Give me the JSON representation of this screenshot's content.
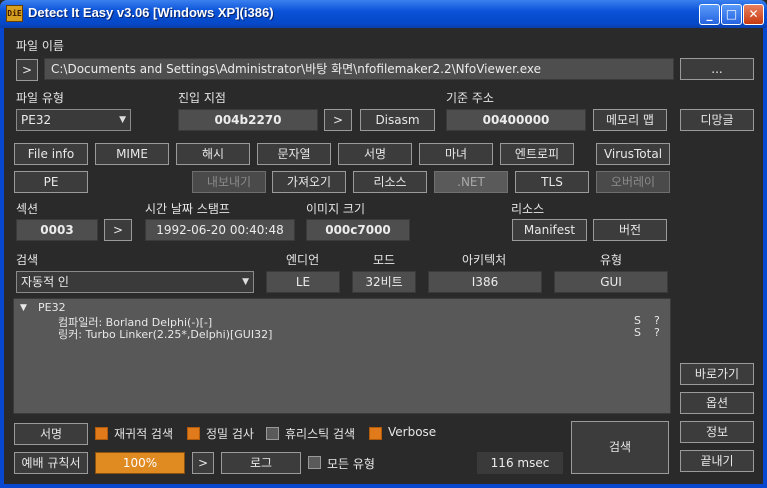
{
  "window": {
    "title": "Detect It Easy v3.06 [Windows XP](i386)",
    "app_icon": "DiE"
  },
  "file": {
    "label": "파일 이름",
    "path": "C:\\Documents and Settings\\Administrator\\바탕 화면\\nfofilemaker2.2\\NfoViewer.exe",
    "browse_label": "...",
    "expand_label": ">"
  },
  "file_type": {
    "label": "파일 유형",
    "value": "PE32"
  },
  "entry_point": {
    "label": "진입 지점",
    "value": "004b2270",
    "go_label": ">",
    "disasm_label": "Disasm"
  },
  "base_address": {
    "label": "기준 주소",
    "value": "00400000",
    "memory_map_label": "메모리 맵"
  },
  "side_buttons": {
    "unpack": "디망글",
    "goto": "바로가기",
    "options": "옵션",
    "info": "정보",
    "exit": "끝내기"
  },
  "toolbar_row1": [
    "File info",
    "MIME",
    "해시",
    "문자열",
    "서명",
    "마녀",
    "엔트로피",
    "VirusTotal"
  ],
  "toolbar_row2": {
    "pe": "PE",
    "export": "내보내기",
    "import": "가져오기",
    "resources": "리소스",
    "dotnet": ".NET",
    "tls": "TLS",
    "overlay": "오버레이"
  },
  "sections": {
    "label": "섹션",
    "value": "0003",
    "go_label": ">"
  },
  "timestamp": {
    "label": "시간 날짜 스탬프",
    "value": "1992-06-20 00:40:48"
  },
  "image_size": {
    "label": "이미지 크기",
    "value": "000c7000"
  },
  "resources_group": {
    "label": "리소스",
    "manifest": "Manifest",
    "version": "버전"
  },
  "scan": {
    "label": "검색",
    "value": "자동적 인"
  },
  "endian": {
    "label": "엔디언",
    "value": "LE"
  },
  "mode": {
    "label": "모드",
    "value": "32비트"
  },
  "architecture": {
    "label": "아키텍처",
    "value": "I386"
  },
  "type": {
    "label": "유형",
    "value": "GUI"
  },
  "results": {
    "root": "PE32",
    "items": [
      {
        "text": "컴파일러: Borland Delphi(-)[-]",
        "s": "S",
        "q": "?"
      },
      {
        "text": "링커: Turbo Linker(2.25*,Delphi)[GUI32]",
        "s": "S",
        "q": "?"
      }
    ]
  },
  "bottom": {
    "signatures": "서명",
    "recursive_scan": "재귀적 검색",
    "deep_scan": "정밀 검사",
    "heuristic_scan": "휴리스틱 검색",
    "verbose": "Verbose",
    "exception_rules": "예배 규칙서",
    "progress": "100%",
    "progress_value": 100,
    "go_label": ">",
    "log": "로그",
    "all_types": "모든 유형",
    "elapsed": "116 msec",
    "scan_button": "검색"
  },
  "colors": {
    "accent": "#e07a1a",
    "titlebar": "#0a52d8",
    "background": "#2a2a2a"
  }
}
